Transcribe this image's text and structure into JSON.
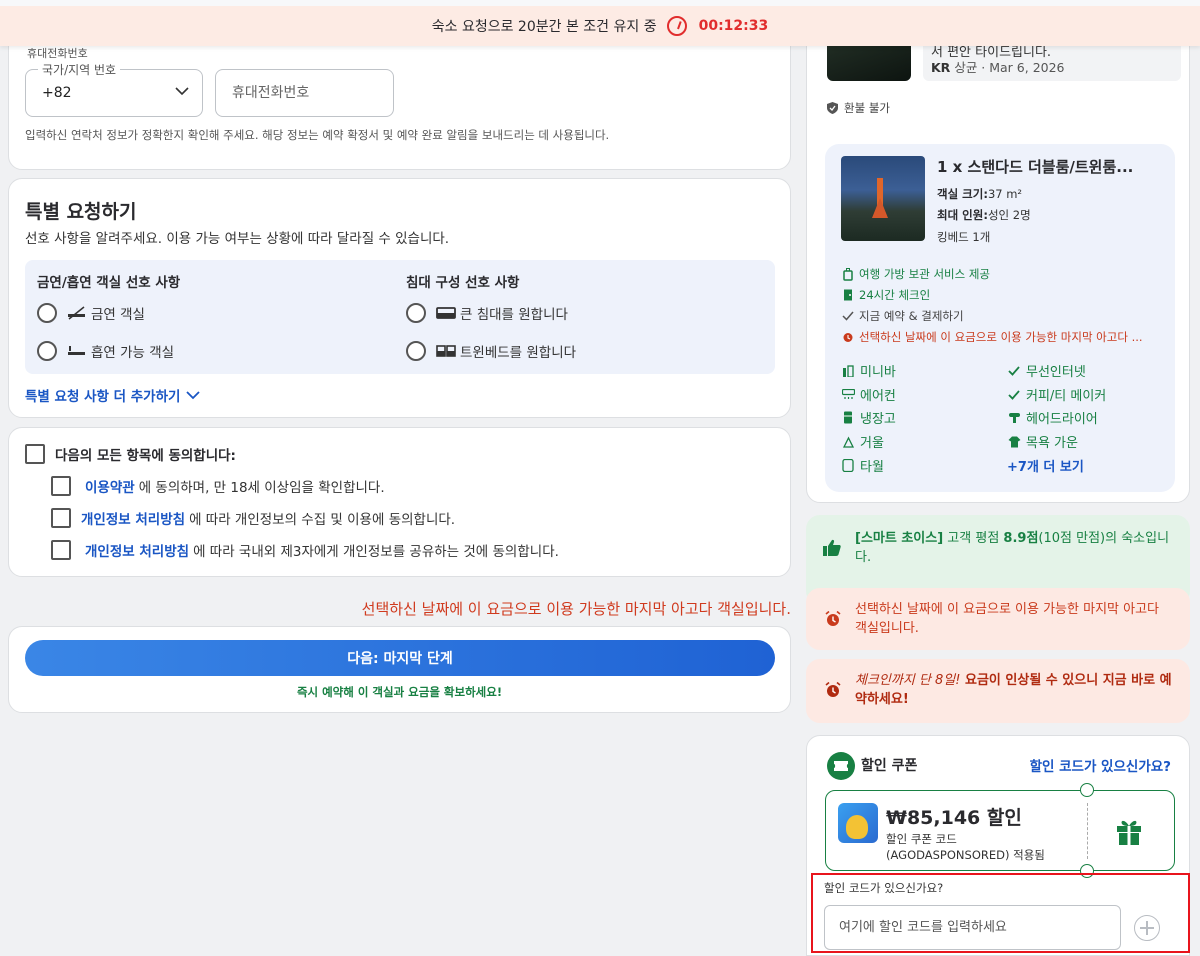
{
  "topbar": {
    "text": "숙소 요청으로 20분간 본 조건 유지 중",
    "timer": "00:12:33"
  },
  "contact": {
    "section_label": "휴대전화번호",
    "country_label": "국가/지역 번호",
    "country_value": "+82",
    "phone_placeholder": "휴대전화번호",
    "note": "입력하신 연락처 정보가 정확한지 확인해 주세요. 해당 정보는 예약 확정서 및 예약 완료 알림을 보내드리는 데 사용됩니다."
  },
  "special": {
    "title": "특별 요청하기",
    "subtitle": "선호 사항을 알려주세요. 이용 가능 여부는 상황에 따라 달라질 수 있습니다.",
    "smoking_header": "금연/흡연 객실 선호 사항",
    "smoking_options": [
      "금연 객실",
      "흡연 가능 객실"
    ],
    "bed_header": "침대 구성 선호 사항",
    "bed_options": [
      "큰 침대를 원합니다",
      "트윈베드를 원합니다"
    ],
    "more_link": "특별 요청 사항 더 추가하기"
  },
  "agree": {
    "master": "다음의 모든 항목에 동의합니다:",
    "items": [
      {
        "link": "이용약관",
        "text": "에 동의하며, 만 18세 이상임을 확인합니다."
      },
      {
        "link": "개인정보 처리방침",
        "text": "에 따라 개인정보의 수집 및 이용에 동의합니다."
      },
      {
        "link": "개인정보 처리방침",
        "text": "에 따라 국내외 제3자에게 개인정보를 공유하는 것에 동의합니다."
      }
    ]
  },
  "last_room_notice": "선택하신 날짜에 이 요금으로 이용 가능한 마지막 아고다 객실입니다.",
  "next": {
    "button": "다음: 마지막 단계",
    "hint": "즉시 예약해 이 객실과 요금을 확보하세요!"
  },
  "review": {
    "text": "서 편안 타이드립니다.",
    "country": "KR",
    "author_date": "상균 · Mar 6, 2026"
  },
  "refund": "환불 불가",
  "room": {
    "name": "1 x 스탠다드 더블룸/트윈룸...",
    "size_label": "객실 크기:",
    "size_value": "37 m²",
    "occupancy_label": "최대 인원:",
    "occupancy_value": "성인 2명",
    "bed": "킹베드 1개",
    "benefits": [
      "여행 가방 보관 서비스 제공",
      "24시간 체크인",
      "지금 예약 & 결제하기",
      "선택하신 날짜에 이 요금으로 이용 가능한 마지막 아고다 ..."
    ],
    "amenities_left": [
      "미니바",
      "에어컨",
      "냉장고",
      "거울",
      "타월"
    ],
    "amenities_right": [
      "무선인터넷",
      "커피/티 메이커",
      "헤어드라이어",
      "목욕 가운"
    ],
    "more_amenities": "+7개 더 보기"
  },
  "smart": {
    "prefix": "[스마트 초이스]",
    "mid": " 고객 평점 ",
    "score": "8.9점",
    "suffix": "(10점 만점)의 숙소입니다."
  },
  "last_room_card": "선택하신 날짜에 이 요금으로 이용 가능한 마지막 아고다 객실입니다.",
  "price_warn": {
    "italic": "체크인까지 단 8일!",
    "bold": " 요금이 인상될 수 있으니 지금 바로 예약하세요!"
  },
  "coupon": {
    "title": "할인 쿠폰",
    "link": "할인 코드가 있으신가요?",
    "amount": "₩85,146 할인",
    "line1": "할인 쿠폰 코드",
    "line2": "(AGODASPONSORED) 적용됨"
  },
  "promo": {
    "label": "할인 코드가 있으신가요?",
    "placeholder": "여기에 할인 코드를 입력하세요"
  },
  "colors": {
    "accent_blue": "#1a56c4",
    "green": "#188043",
    "red": "#c93a1c",
    "timer_red": "#e12d2d"
  }
}
